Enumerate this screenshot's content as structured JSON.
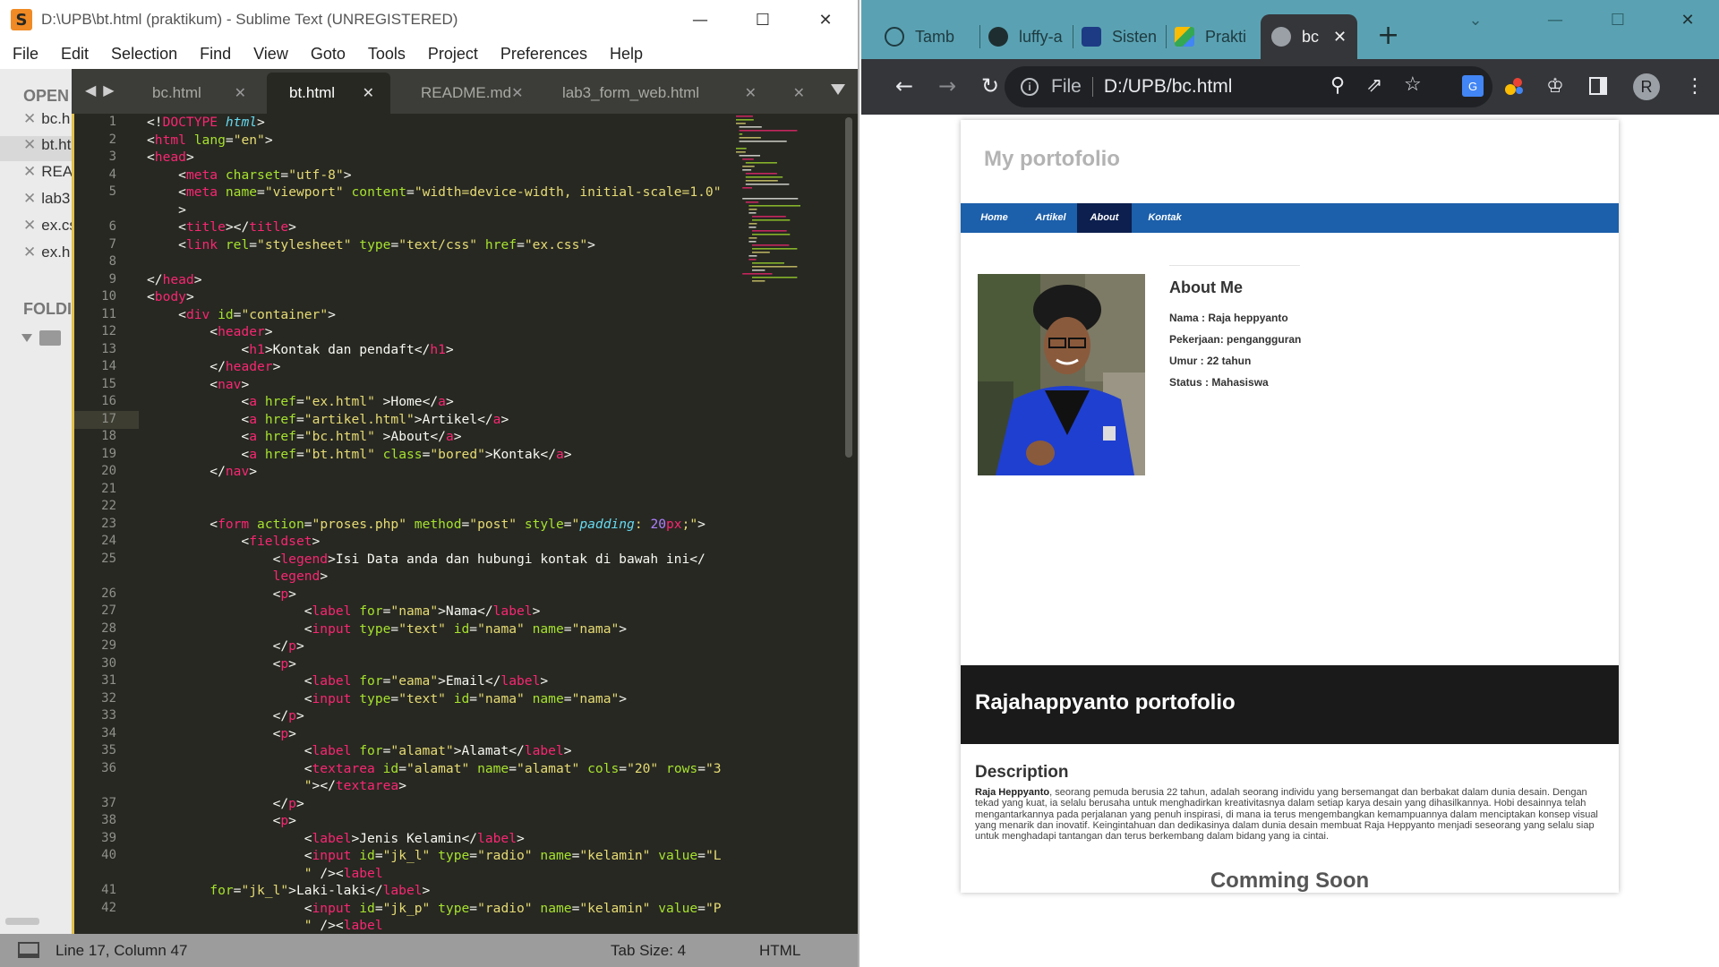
{
  "sublime": {
    "title": "D:\\UPB\\bt.html (praktikum) - Sublime Text (UNREGISTERED)",
    "menu": [
      "File",
      "Edit",
      "Selection",
      "Find",
      "View",
      "Goto",
      "Tools",
      "Project",
      "Preferences",
      "Help"
    ],
    "sidebar": {
      "open_files_label": "OPEN",
      "files": [
        "bc.h",
        "bt.ht",
        "REA",
        "lab3",
        "ex.cs",
        "ex.h"
      ],
      "folders_label": "FOLDI"
    },
    "tabs": [
      {
        "label": "bc.html",
        "active": false
      },
      {
        "label": "bt.html",
        "active": true
      },
      {
        "label": "README.md",
        "active": false
      },
      {
        "label": "lab3_form_web.html",
        "active": false
      }
    ],
    "status": {
      "position": "Line 17, Column 47",
      "tab_size": "Tab Size: 4",
      "syntax": "HTML"
    }
  },
  "chrome": {
    "tabs": [
      {
        "label": "Tamb",
        "favicon": "openai-icon",
        "active": false
      },
      {
        "label": "luffy-a",
        "favicon": "github-icon",
        "active": false
      },
      {
        "label": "Sisten",
        "favicon": "university-icon",
        "active": false
      },
      {
        "label": "Prakti",
        "favicon": "google-drive-icon",
        "active": false
      },
      {
        "label": "bc",
        "favicon": "globe-icon",
        "active": true
      }
    ],
    "address_scheme": "File",
    "address": "D:/UPB/bc.html",
    "profile_initial": "R"
  },
  "page": {
    "site_title": "My portofolio",
    "nav": [
      {
        "label": "Home",
        "active": false
      },
      {
        "label": "Artikel",
        "active": false
      },
      {
        "label": "About",
        "active": true
      },
      {
        "label": "Kontak",
        "active": false
      }
    ],
    "about_heading": "About Me",
    "about_items": [
      "Nama : Raja heppyanto",
      "Pekerjaan: pengangguran",
      "Umur : 22 tahun",
      "Status : Mahasiswa"
    ],
    "footer_heading": "Rajahappyanto portofolio",
    "description_heading": "Description",
    "description_name": "Raja Heppyanto",
    "description_text": ", seorang pemuda berusia 22 tahun, adalah seorang individu yang bersemangat dan berbakat dalam dunia desain. Dengan tekad yang kuat, ia selalu berusaha untuk menghadirkan kreativitasnya dalam setiap karya desain yang dihasilkannya. Hobi desainnya telah mengantarkannya pada perjalanan yang penuh inspirasi, di mana ia terus mengembangkan kemampuannya dalam menciptakan konsep visual yang menarik dan inovatif. Keingintahuan dan dedikasinya dalam dunia desain membuat Raja Heppyanto menjadi seseorang yang selalu siap untuk menghadapi tantangan dan terus berkembang dalam bidang yang ia cintai.",
    "coming_soon": "Comming Soon"
  },
  "code_lines": [
    {
      "n": "1",
      "html": "&lt;!<span class='t'>DOCTYPE</span> <span class='k'>html</span>&gt;"
    },
    {
      "n": "2",
      "html": "&lt;<span class='t'>html</span> <span class='a'>lang</span>=<span class='s'>\"en\"</span>&gt;"
    },
    {
      "n": "3",
      "html": "&lt;<span class='t'>head</span>&gt;"
    },
    {
      "n": "4",
      "html": "    &lt;<span class='t'>meta</span> <span class='a'>charset</span>=<span class='s'>\"utf-8\"</span>&gt;"
    },
    {
      "n": "5",
      "html": "    &lt;<span class='t'>meta</span> <span class='a'>name</span>=<span class='s'>\"viewport\"</span> <span class='a'>content</span>=<span class='s'>\"width=device-width, initial-scale=1.0\"</span>"
    },
    {
      "n": "",
      "html": "    &gt;"
    },
    {
      "n": "6",
      "html": "    &lt;<span class='t'>title</span>&gt;&lt;/<span class='t'>title</span>&gt;"
    },
    {
      "n": "7",
      "html": "    &lt;<span class='t'>link</span> <span class='a'>rel</span>=<span class='s'>\"stylesheet\"</span> <span class='a'>type</span>=<span class='s'>\"text/css\"</span> <span class='a'>href</span>=<span class='s'>\"ex.css\"</span>&gt;"
    },
    {
      "n": "8",
      "html": ""
    },
    {
      "n": "9",
      "html": "&lt;/<span class='t'>head</span>&gt;"
    },
    {
      "n": "10",
      "html": "&lt;<span class='t'>body</span>&gt;"
    },
    {
      "n": "11",
      "html": "    &lt;<span class='t'>div</span> <span class='a'>id</span>=<span class='s'>\"container\"</span>&gt;"
    },
    {
      "n": "12",
      "html": "        &lt;<span class='t'>header</span>&gt;"
    },
    {
      "n": "13",
      "html": "            &lt;<span class='t'>h1</span>&gt;Kontak dan pendaft&lt;/<span class='t'>h1</span>&gt;"
    },
    {
      "n": "14",
      "html": "        &lt;/<span class='t'>header</span>&gt;"
    },
    {
      "n": "15",
      "html": "        &lt;<span class='t'>nav</span>&gt;"
    },
    {
      "n": "16",
      "html": "            &lt;<span class='t'>a</span> <span class='a'>href</span>=<span class='s'>\"ex.html\"</span> &gt;Home&lt;/<span class='t'>a</span>&gt;"
    },
    {
      "n": "17",
      "html": "            &lt;<span class='t'>a</span> <span class='a'>href</span>=<span class='s'>\"artikel.html\"</span>&gt;Artikel&lt;/<span class='t'>a</span>&gt;"
    },
    {
      "n": "18",
      "html": "            &lt;<span class='t'>a</span> <span class='a'>href</span>=<span class='s'>\"bc.html\"</span> &gt;About&lt;/<span class='t'>a</span>&gt;"
    },
    {
      "n": "19",
      "html": "            &lt;<span class='t'>a</span> <span class='a'>href</span>=<span class='s'>\"bt.html\"</span> <span class='a'>class</span>=<span class='s'>\"bored\"</span>&gt;Kontak&lt;/<span class='t'>a</span>&gt;"
    },
    {
      "n": "20",
      "html": "        &lt;/<span class='t'>nav</span>&gt;"
    },
    {
      "n": "21",
      "html": ""
    },
    {
      "n": "22",
      "html": ""
    },
    {
      "n": "23",
      "html": "        &lt;<span class='t'>form</span> <span class='a'>action</span>=<span class='s'>\"proses.php\"</span> <span class='a'>method</span>=<span class='s'>\"post\"</span> <span class='a'>style</span>=<span class='s'>\"<span class='k'>padding</span>: <span class='n'>20</span><span class='t'>px</span>;\"</span>&gt;"
    },
    {
      "n": "24",
      "html": "            &lt;<span class='t'>fieldset</span>&gt;"
    },
    {
      "n": "25",
      "html": "                &lt;<span class='t'>legend</span>&gt;Isi Data anda dan hubungi kontak di bawah ini&lt;/"
    },
    {
      "n": "",
      "html": "                <span class='t'>legend</span>&gt;"
    },
    {
      "n": "26",
      "html": "                &lt;<span class='t'>p</span>&gt;"
    },
    {
      "n": "27",
      "html": "                    &lt;<span class='t'>label</span> <span class='a'>for</span>=<span class='s'>\"nama\"</span>&gt;Nama&lt;/<span class='t'>label</span>&gt;"
    },
    {
      "n": "28",
      "html": "                    &lt;<span class='t'>input</span> <span class='a'>type</span>=<span class='s'>\"text\"</span> <span class='a'>id</span>=<span class='s'>\"nama\"</span> <span class='a'>name</span>=<span class='s'>\"nama\"</span>&gt;"
    },
    {
      "n": "29",
      "html": "                &lt;/<span class='t'>p</span>&gt;"
    },
    {
      "n": "30",
      "html": "                &lt;<span class='t'>p</span>&gt;"
    },
    {
      "n": "31",
      "html": "                    &lt;<span class='t'>label</span> <span class='a'>for</span>=<span class='s'>\"eama\"</span>&gt;Email&lt;/<span class='t'>label</span>&gt;"
    },
    {
      "n": "32",
      "html": "                    &lt;<span class='t'>input</span> <span class='a'>type</span>=<span class='s'>\"text\"</span> <span class='a'>id</span>=<span class='s'>\"nama\"</span> <span class='a'>name</span>=<span class='s'>\"nama\"</span>&gt;"
    },
    {
      "n": "33",
      "html": "                &lt;/<span class='t'>p</span>&gt;"
    },
    {
      "n": "34",
      "html": "                &lt;<span class='t'>p</span>&gt;"
    },
    {
      "n": "35",
      "html": "                    &lt;<span class='t'>label</span> <span class='a'>for</span>=<span class='s'>\"alamat\"</span>&gt;Alamat&lt;/<span class='t'>label</span>&gt;"
    },
    {
      "n": "36",
      "html": "                    &lt;<span class='t'>textarea</span> <span class='a'>id</span>=<span class='s'>\"alamat\"</span> <span class='a'>name</span>=<span class='s'>\"alamat\"</span> <span class='a'>cols</span>=<span class='s'>\"20\"</span> <span class='a'>rows</span>=<span class='s'>\"3</span>"
    },
    {
      "n": "",
      "html": "                    <span class='s'>\"</span>&gt;&lt;/<span class='t'>textarea</span>&gt;"
    },
    {
      "n": "37",
      "html": "                &lt;/<span class='t'>p</span>&gt;"
    },
    {
      "n": "38",
      "html": "                &lt;<span class='t'>p</span>&gt;"
    },
    {
      "n": "39",
      "html": "                    &lt;<span class='t'>label</span>&gt;Jenis Kelamin&lt;/<span class='t'>label</span>&gt;"
    },
    {
      "n": "40",
      "html": "                    &lt;<span class='t'>input</span> <span class='a'>id</span>=<span class='s'>\"jk_l\"</span> <span class='a'>type</span>=<span class='s'>\"radio\"</span> <span class='a'>name</span>=<span class='s'>\"kelamin\"</span> <span class='a'>value</span>=<span class='s'>\"L</span>"
    },
    {
      "n": "",
      "html": "                    <span class='s'>\"</span> /&gt;&lt;<span class='t'>label</span>"
    },
    {
      "n": "41",
      "html": "        <span class='a'>for</span>=<span class='s'>\"jk_l\"</span>&gt;Laki-laki&lt;/<span class='t'>label</span>&gt;"
    },
    {
      "n": "42",
      "html": "                    &lt;<span class='t'>input</span> <span class='a'>id</span>=<span class='s'>\"jk_p\"</span> <span class='a'>type</span>=<span class='s'>\"radio\"</span> <span class='a'>name</span>=<span class='s'>\"kelamin\"</span> <span class='a'>value</span>=<span class='s'>\"P</span>"
    },
    {
      "n": "",
      "html": "                    <span class='s'>\"</span> /&gt;&lt;<span class='t'>label</span>"
    }
  ]
}
